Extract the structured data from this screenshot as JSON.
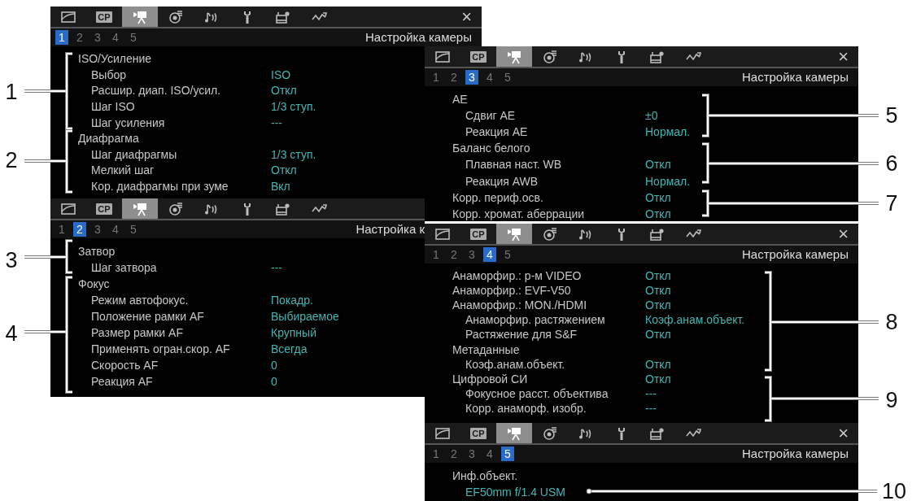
{
  "screens": [
    {
      "tabs": [
        {
          "kind": "picture",
          "selected": false
        },
        {
          "kind": "cp",
          "label": "CP",
          "selected": false
        },
        {
          "kind": "camera",
          "selected": true
        },
        {
          "kind": "reel",
          "selected": false
        },
        {
          "kind": "audio",
          "selected": false
        },
        {
          "kind": "wrench",
          "selected": false
        },
        {
          "kind": "monitor",
          "selected": false
        },
        {
          "kind": "wave",
          "selected": false
        }
      ],
      "close": "×",
      "pages": [
        {
          "label": "1",
          "selected": true
        },
        {
          "label": "2",
          "selected": false
        },
        {
          "label": "3",
          "selected": false
        },
        {
          "label": "4",
          "selected": false
        },
        {
          "label": "5",
          "selected": false
        }
      ],
      "title": "Настройка камеры",
      "items": [
        {
          "label": "ISO/Усиление",
          "children": [
            {
              "label": "Выбор",
              "value": "ISO"
            },
            {
              "label": "Расшир. диап. ISO/усил.",
              "value": "Откл"
            },
            {
              "label": "Шаг ISO",
              "value": "1/3 ступ."
            },
            {
              "label": "Шаг усиления",
              "value": "---"
            }
          ]
        },
        {
          "label": "Диафрагма",
          "children": [
            {
              "label": "Шаг диафрагмы",
              "value": "1/3 ступ."
            },
            {
              "label": "Мелкий шаг",
              "value": "Откл"
            },
            {
              "label": "Кор. диафрагмы при зуме",
              "value": "Вкл"
            }
          ]
        }
      ]
    },
    {
      "tabs": [
        {
          "kind": "picture",
          "selected": false
        },
        {
          "kind": "cp",
          "label": "CP",
          "selected": false
        },
        {
          "kind": "camera",
          "selected": true
        },
        {
          "kind": "reel",
          "selected": false
        },
        {
          "kind": "audio",
          "selected": false
        },
        {
          "kind": "wrench",
          "selected": false
        },
        {
          "kind": "monitor",
          "selected": false
        },
        {
          "kind": "wave",
          "selected": false
        }
      ],
      "pages": [
        {
          "label": "1",
          "selected": false
        },
        {
          "label": "2",
          "selected": true
        },
        {
          "label": "3",
          "selected": false
        },
        {
          "label": "4",
          "selected": false
        },
        {
          "label": "5",
          "selected": false
        }
      ],
      "title": "Настройка к",
      "items": [
        {
          "label": "Затвор",
          "children": [
            {
              "label": "Шаг затвора",
              "value": "---"
            }
          ]
        },
        {
          "label": "Фокус",
          "children": [
            {
              "label": "Режим автофокус.",
              "value": "Покадр."
            },
            {
              "label": "Положение рамки AF",
              "value": "Выбираемое"
            },
            {
              "label": "Размер рамки AF",
              "value": "Крупный"
            },
            {
              "label": "Применять огран.скор. AF",
              "value": "Всегда"
            },
            {
              "label": "Скорость AF",
              "value": "0"
            },
            {
              "label": "Реакция AF",
              "value": "0"
            }
          ]
        }
      ]
    },
    {
      "tabs": [
        {
          "kind": "picture",
          "selected": false
        },
        {
          "kind": "cp",
          "label": "CP",
          "selected": false
        },
        {
          "kind": "camera",
          "selected": true
        },
        {
          "kind": "reel",
          "selected": false
        },
        {
          "kind": "audio",
          "selected": false
        },
        {
          "kind": "wrench",
          "selected": false
        },
        {
          "kind": "monitor",
          "selected": false
        },
        {
          "kind": "wave",
          "selected": false
        }
      ],
      "close": "×",
      "pages": [
        {
          "label": "1",
          "selected": false
        },
        {
          "label": "2",
          "selected": false
        },
        {
          "label": "3",
          "selected": true
        },
        {
          "label": "4",
          "selected": false
        },
        {
          "label": "5",
          "selected": false
        }
      ],
      "title": "Настройка камеры",
      "items": [
        {
          "label": "AE",
          "children": [
            {
              "label": "Сдвиг AE",
              "value": "±0"
            },
            {
              "label": "Реакция AE",
              "value": "Нормал."
            }
          ]
        },
        {
          "label": "Баланс белого",
          "children": [
            {
              "label": "Плавная наст. WB",
              "value": "Откл"
            },
            {
              "label": "Реакция AWB",
              "value": "Нормал."
            }
          ]
        },
        {
          "label": "Корр. периф.осв.",
          "value": "Откл"
        },
        {
          "label": "Корр. хромат. аберрации",
          "value": "Откл"
        }
      ]
    },
    {
      "tabs": [
        {
          "kind": "picture",
          "selected": false
        },
        {
          "kind": "cp",
          "label": "CP",
          "selected": false
        },
        {
          "kind": "camera",
          "selected": true
        },
        {
          "kind": "reel",
          "selected": false
        },
        {
          "kind": "audio",
          "selected": false
        },
        {
          "kind": "wrench",
          "selected": false
        },
        {
          "kind": "monitor",
          "selected": false
        },
        {
          "kind": "wave",
          "selected": false
        }
      ],
      "close": "×",
      "pages": [
        {
          "label": "1",
          "selected": false
        },
        {
          "label": "2",
          "selected": false
        },
        {
          "label": "3",
          "selected": false
        },
        {
          "label": "4",
          "selected": true
        },
        {
          "label": "5",
          "selected": false
        }
      ],
      "title": "Настройка камеры",
      "items": [
        {
          "label": "Анаморфир.: р-м VIDEO",
          "value": "Откл"
        },
        {
          "label": "Анаморфир.: EVF-V50",
          "value": "Откл"
        },
        {
          "label": "Анаморфир.: MON./HDMI",
          "value": "Откл",
          "children": [
            {
              "label": "Анаморфир. растяжением",
              "value": "Коэф.анам.объект."
            },
            {
              "label": "Растяжение для S&F",
              "value": "Откл"
            }
          ]
        },
        {
          "label": "Метаданные",
          "children": [
            {
              "label": "Коэф.анам.объект.",
              "value": "Откл"
            }
          ]
        },
        {
          "label": "Цифровой СИ",
          "value": "Откл",
          "children": [
            {
              "label": "Фокусное расст. объектива",
              "value": "---"
            },
            {
              "label": "Корр. анаморф. изобр.",
              "value": "---"
            }
          ]
        }
      ]
    },
    {
      "tabs": [
        {
          "kind": "picture",
          "selected": false
        },
        {
          "kind": "cp",
          "label": "CP",
          "selected": false
        },
        {
          "kind": "camera",
          "selected": true
        },
        {
          "kind": "reel",
          "selected": false
        },
        {
          "kind": "audio",
          "selected": false
        },
        {
          "kind": "wrench",
          "selected": false
        },
        {
          "kind": "monitor",
          "selected": false
        },
        {
          "kind": "wave",
          "selected": false
        }
      ],
      "close": "×",
      "pages": [
        {
          "label": "1",
          "selected": false
        },
        {
          "label": "2",
          "selected": false
        },
        {
          "label": "3",
          "selected": false
        },
        {
          "label": "4",
          "selected": false
        },
        {
          "label": "5",
          "selected": true
        }
      ],
      "title": "Настройка камеры",
      "items": [
        {
          "label": "Инф.объект.",
          "children": [
            {
              "value": "EF50mm f/1.4 USM"
            }
          ]
        }
      ]
    }
  ],
  "callouts": [
    {
      "number": "1"
    },
    {
      "number": "2"
    },
    {
      "number": "3"
    },
    {
      "number": "4"
    },
    {
      "number": "5"
    },
    {
      "number": "6"
    },
    {
      "number": "7"
    },
    {
      "number": "8"
    },
    {
      "number": "9"
    },
    {
      "number": "10"
    }
  ]
}
